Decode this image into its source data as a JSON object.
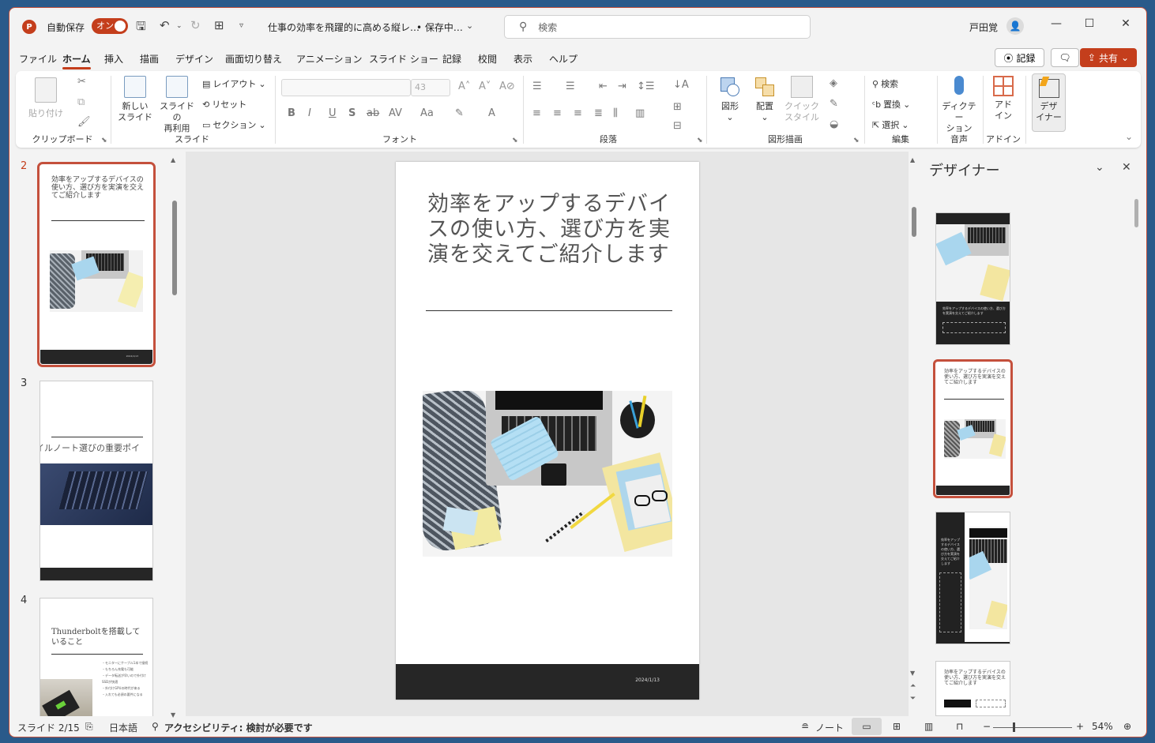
{
  "titlebar": {
    "app_logo": "P",
    "autosave_label": "自動保存",
    "autosave_state": "オン",
    "doc_title": "仕事の効率を飛躍的に高める縦レ…",
    "save_status": "• 保存中…",
    "search_placeholder": "検索",
    "user_name": "戸田覚"
  },
  "menu": {
    "tabs": [
      "ファイル",
      "ホーム",
      "挿入",
      "描画",
      "デザイン",
      "画面切り替え",
      "アニメーション",
      "スライド ショー",
      "記録",
      "校閲",
      "表示",
      "ヘルプ"
    ],
    "active_tab": "ホーム",
    "record_label": "記録",
    "share_label": "共有"
  },
  "ribbon": {
    "clipboard": {
      "paste": "貼り付け",
      "label": "クリップボード"
    },
    "slides": {
      "new_slide_1": "新しい",
      "new_slide_2": "スライド",
      "reuse_1": "スライドの",
      "reuse_2": "再利用",
      "layout": "レイアウト",
      "reset": "リセット",
      "section": "セクション",
      "label": "スライド"
    },
    "font": {
      "size": "43",
      "label": "フォント"
    },
    "paragraph": {
      "label": "段落"
    },
    "drawing": {
      "shapes": "図形",
      "arrange": "配置",
      "quick_1": "クイック",
      "quick_2": "スタイル",
      "label": "図形描画"
    },
    "editing": {
      "find": "検索",
      "replace": "置換",
      "select": "選択",
      "label": "編集"
    },
    "voice": {
      "dictate_1": "ディクテー",
      "dictate_2": "ション",
      "label": "音声"
    },
    "addins": {
      "addin_1": "アド",
      "addin_2": "イン",
      "label": "アドイン"
    },
    "designer": {
      "label_1": "デザ",
      "label_2": "イナー"
    }
  },
  "thumbnails": [
    {
      "num": "2",
      "title": "効率をアップするデバイスの使い方、選び方を実演を交えてご紹介します",
      "footer": "2024/1/13"
    },
    {
      "num": "3",
      "title": "イルノート選びの重要ポイ"
    },
    {
      "num": "4",
      "title": "Thunderboltを搭載していること",
      "bullets": [
        "・モニターにケーブル1本で接続",
        "・もちろん充電も可能",
        "・データ転送が早いので外付けSSDが快適",
        "・外付けGPUの時代が来る",
        "・入れても必須の要件になる"
      ]
    }
  ],
  "slide": {
    "title": "効率をアップするデバイスの使い方、選び方を実演を交えてご紹介します",
    "date": "2024/1/13"
  },
  "designer_pane": {
    "title": "デザイナー",
    "option_text": "効率をアップするデバイスの使い方、選び方を実演を交えてご紹介します"
  },
  "status": {
    "slide_count": "スライド 2/15",
    "language": "日本語",
    "accessibility": "アクセシビリティ: 検討が必要です",
    "notes": "ノート",
    "zoom": "54%"
  },
  "colors": {
    "accent": "#c43e1c",
    "footer_dark": "#262626"
  }
}
